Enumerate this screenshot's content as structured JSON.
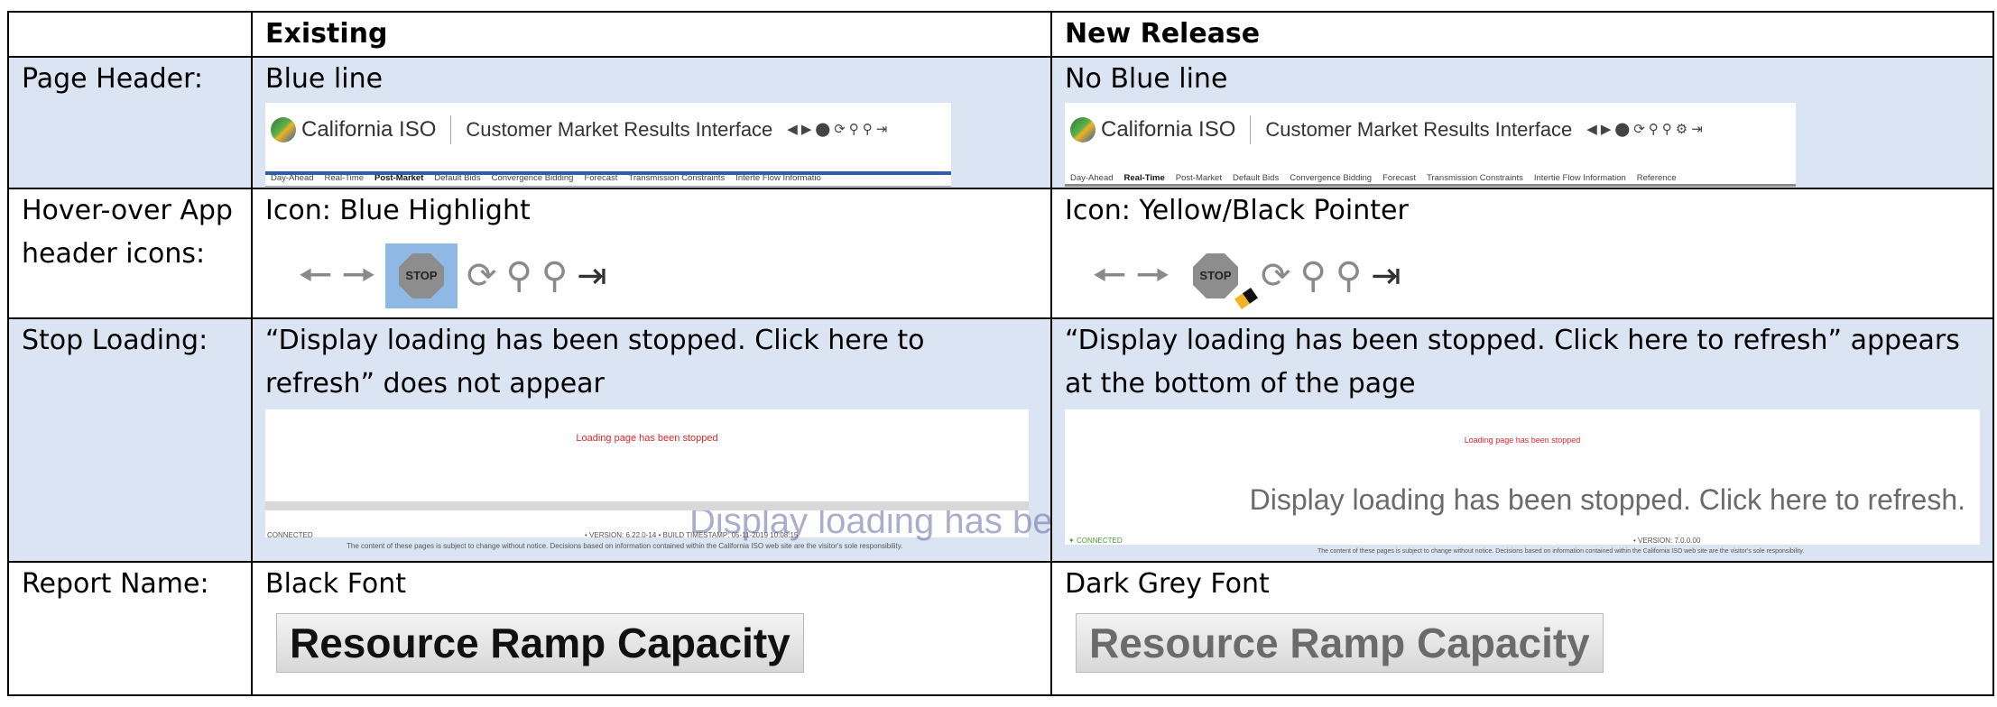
{
  "columns": {
    "blank": "",
    "existing": "Existing",
    "new_release": "New Release"
  },
  "rows": [
    {
      "label": "Page Header:",
      "existing": "Blue line",
      "new_release": "No Blue line"
    },
    {
      "label": "Hover-over App header icons:",
      "existing": "Icon: Blue Highlight",
      "new_release": "Icon: Yellow/Black Pointer"
    },
    {
      "label": "Stop Loading:",
      "existing": "“Display loading has been stopped. Click here to refresh” does not appear",
      "new_release": "“Display loading has been stopped. Click here to refresh” appears at the bottom of the page"
    },
    {
      "label": "Report Name:",
      "existing": "Black Font",
      "new_release": "Dark Grey Font"
    }
  ],
  "header_shot": {
    "logo": "California ISO",
    "app_title": "Customer Market Results Interface",
    "nav_existing": [
      "Day-Ahead",
      "Real-Time",
      "Post-Market",
      "Default Bids",
      "Convergence Bidding",
      "Forecast",
      "Transmission Constraints",
      "Interte Flow Informatio"
    ],
    "nav_new": [
      "Day-Ahead",
      "Real-Time",
      "Post-Market",
      "Default Bids",
      "Convergence Bidding",
      "Forecast",
      "Transmission Constraints",
      "Intertie Flow Information",
      "Reference"
    ]
  },
  "icons": {
    "stop_label": "STOP"
  },
  "loading": {
    "red_text": "Loading page has been stopped",
    "refresh_text": "Display loading has been stopped. Click here to refresh.",
    "connected": "CONNECTED",
    "version_existing": "• VERSION: 6.22.0-14  •  BUILD TIMESTAMP: 05-11-2019 10:08:15",
    "version_new": "• VERSION: 7.0.0.00",
    "disclaimer": "The content of these pages is subject to change without notice. Decisions based on information contained within the California ISO web site are the visitor's sole responsibility."
  },
  "report_name": "Resource Ramp Capacity",
  "colors": {
    "highlight_row": "#dbe4f2",
    "blue_line": "#2e5fa8",
    "hover_highlight": "#8fb8e4",
    "error_red": "#e0262b",
    "dark_grey_font": "#6b6b6b"
  }
}
